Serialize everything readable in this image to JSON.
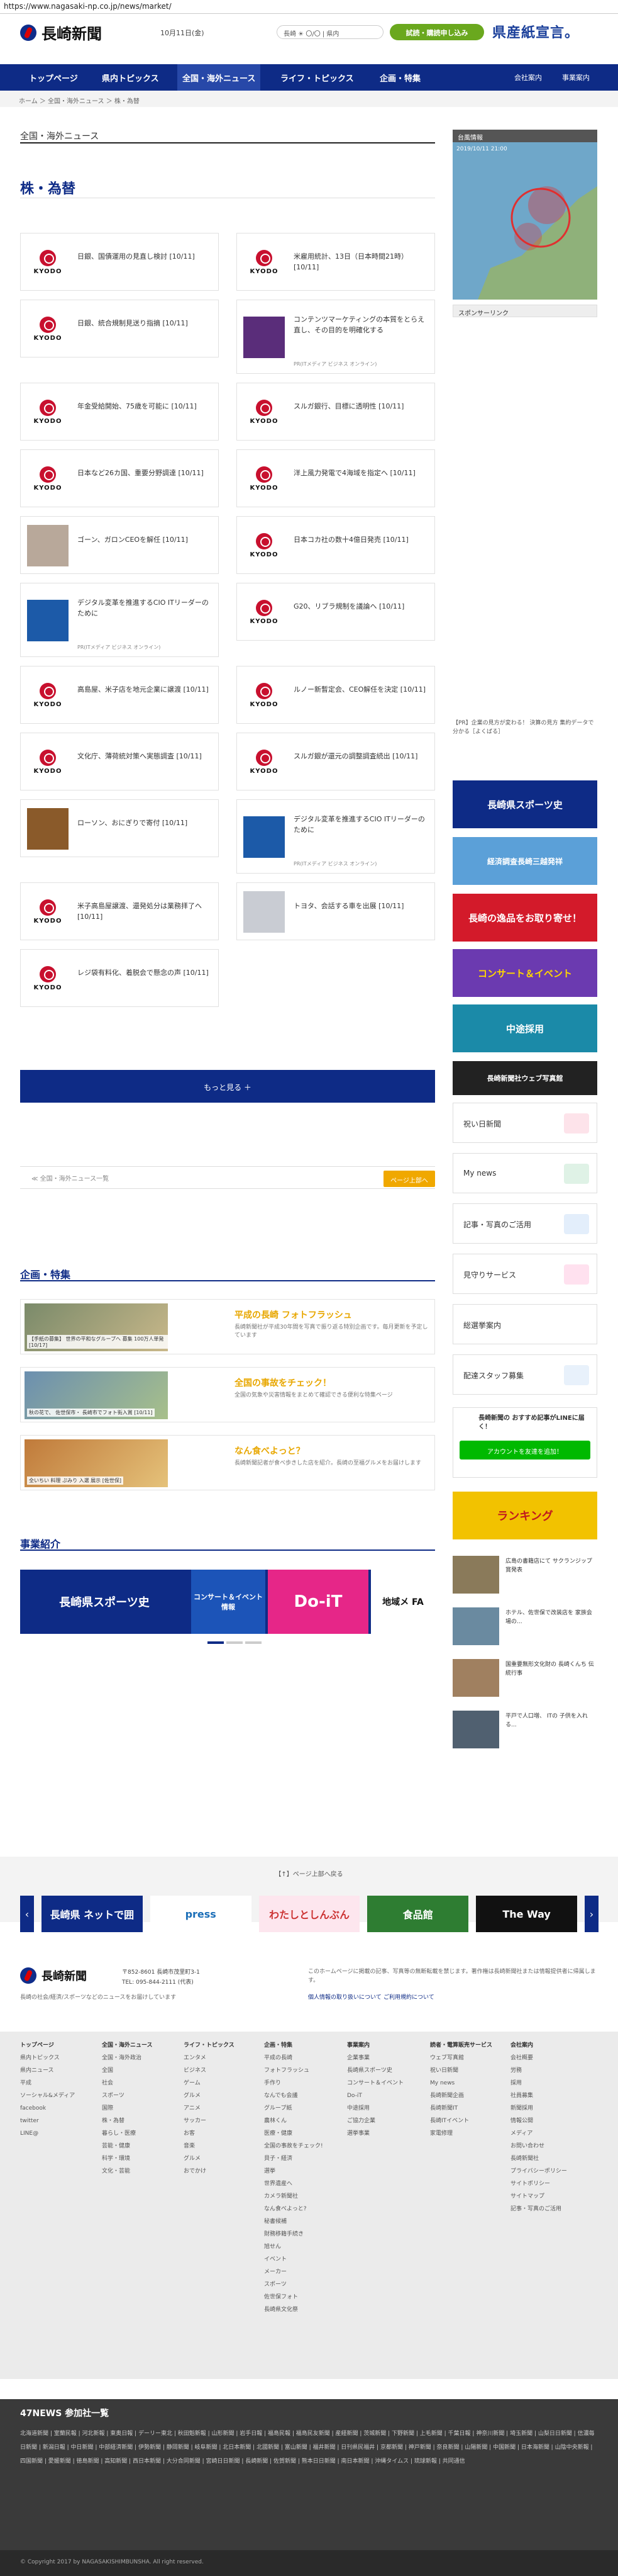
{
  "url": "https://www.nagasaki-np.co.jp/news/market/",
  "header": {
    "logo": "長崎新聞",
    "date": "10月11日(金)",
    "weather": "長崎 ☀ 〇/〇 | 県内",
    "trial_button": "試読・購読申し込み",
    "ad_text": "県産紙宣言。"
  },
  "nav": {
    "items": [
      "トップページ",
      "県内トピックス",
      "全国・海外ニュース",
      "ライフ・トピックス",
      "企画・特集"
    ],
    "right": [
      "会社案内",
      "事業案内"
    ]
  },
  "breadcrumb": "ホーム ＞ 全国・海外ニュース ＞ 株・為替",
  "section_title": "全国・海外ニュース",
  "page_title": "株・為替",
  "articles": [
    {
      "title": "日銀、国債運用の見直し検討 [10/11]",
      "src": "",
      "thumb": "kyodo"
    },
    {
      "title": "米雇用統計、13日（日本時間21時） [10/11]",
      "src": "",
      "thumb": "kyodo"
    },
    {
      "title": "日銀、統合規制見送り指摘 [10/11]",
      "src": "",
      "thumb": "kyodo"
    },
    {
      "title": "コンテンツマーケティングの本質をとらえ直し、その目的を明確化する",
      "src": "PR(ITメディア ビジネス オンライン)",
      "thumb": "purple"
    },
    {
      "title": "年金受給開始、75歳を可能に [10/11]",
      "src": "",
      "thumb": "kyodo"
    },
    {
      "title": "スルガ銀行、目標に透明性 [10/11]",
      "src": "",
      "thumb": "kyodo"
    },
    {
      "title": "日本など26カ国、重要分野調達 [10/11]",
      "src": "",
      "thumb": "kyodo"
    },
    {
      "title": "洋上風力発電で4海域を指定へ [10/11]",
      "src": "",
      "thumb": "kyodo"
    },
    {
      "title": "ゴーン、ガロンCEOを解任 [10/11]",
      "src": "",
      "thumb": "person"
    },
    {
      "title": "日本コカ社の数十4億日発売 [10/11]",
      "src": "",
      "thumb": "kyodo"
    },
    {
      "title": "デジタル変革を推進するCIO ITリーダーのために",
      "src": "PR(ITメディア ビジネス オンライン)",
      "thumb": "blue"
    },
    {
      "title": "G20、リブラ規制を議論へ [10/11]",
      "src": "",
      "thumb": "kyodo"
    },
    {
      "title": "高島屋、米子店を地元企業に譲渡 [10/11]",
      "src": "",
      "thumb": "kyodo"
    },
    {
      "title": "ルノー新暫定会、CEO解任を決定 [10/11]",
      "src": "",
      "thumb": "kyodo"
    },
    {
      "title": "文化庁、薄荷統対策へ実態調査 [10/11]",
      "src": "",
      "thumb": "kyodo"
    },
    {
      "title": "スルガ銀が還元の調整調査続出 [10/11]",
      "src": "",
      "thumb": "kyodo"
    },
    {
      "title": "ローソン、おにぎりで寄付 [10/11]",
      "src": "",
      "thumb": "food"
    },
    {
      "title": "デジタル変革を推進するCIO ITリーダーのために",
      "src": "PR(ITメディア ビジネス オンライン)",
      "thumb": "blue"
    },
    {
      "title": "米子高島屋譲渡、還発処分は業務拝了へ [10/11]",
      "src": "",
      "thumb": "kyodo"
    },
    {
      "title": "トヨタ、会話する車を出展 [10/11]",
      "src": "",
      "thumb": "car"
    },
    {
      "title": "レジ袋有料化、着脱会で懸念の声 [10/11]",
      "src": "",
      "thumb": "kyodo"
    }
  ],
  "more_button": "もっと見る ＋",
  "pager": {
    "back": "≪ 全国・海外ニュース一覧",
    "top": "ページ上部へ"
  },
  "features": {
    "title": "企画・特集",
    "items": [
      {
        "caption": "【手紙の募集】 世界の平和なグループへ 募集 100万人単発 [10/17]",
        "title": "平成の長崎 フォトフラッシュ",
        "desc": "長崎新聞社が平成30年間を写真で振り返る特別企画です。毎月更新を予定しています"
      },
      {
        "caption": "秋の花で、 佐世保市・ 長崎市でフォト街入賞 [10/11]",
        "title": "全国の事故をチェック！",
        "desc": "全国の気象や災害情報をまとめて確認できる便利な特集ページ"
      },
      {
        "caption": "全いちい 料理 ぷみり 入選 展示 [佐世保]",
        "title": "なん食べよっと？",
        "desc": "長崎新聞記者が食べ歩きした店を紹介。長崎の至福グルメをお届けします"
      }
    ]
  },
  "business": {
    "title": "事業紹介",
    "items": [
      "長崎県スポーツ史",
      "コンサート＆イベント情報",
      "Do-iT",
      "地域メ FA"
    ]
  },
  "sidebar": {
    "map_title": "台風情報",
    "map_date": "2019/10/11 21:00",
    "sponsor": "スポンサーリンク",
    "pr_link": "【PR】企業の見方が変わる！ 決算の見方 集約データで分かる［よくばる］",
    "banners": [
      "長崎県スポーツ史",
      "経済調査長崎三越発祥",
      "長崎の逸品をお取り寄せ！",
      "コンサート＆イベント",
      "中途採用",
      "長崎新聞社ウェブ写真館"
    ],
    "buttons": [
      "祝い日新聞",
      "My news",
      "記事・写真のご活用",
      "見守りサービス",
      "総選挙案内",
      "配達スタッフ募集"
    ],
    "line_title": "長崎新聞の おすすめ記事がLINEに届く！",
    "line_button": "アカウントを友達を追加！",
    "ranking": "ランキング",
    "news": [
      "広島の書籍店にて サクランジップ賞発表",
      "ホテル、佐世保で改装店を 家族会場の...",
      "国重要無形文化財の 長崎くんち 伝統行事",
      "平戸で人口増、 ITの 子供を入れる..."
    ]
  },
  "footer": {
    "pr_back": "【↑】ページ上部へ戻る",
    "carousel": [
      "長崎県 ネットで囲",
      "press",
      "わたしとしんぶん",
      "食品館",
      "The Way"
    ],
    "address": "〒852-8601 長崎市茂里町3-1",
    "tel": "TEL: 095-844-2111 (代表)",
    "note": "長崎の社会/経済/スポーツなどのニュースをお届けしています",
    "right_note": "このホームページに掲載の記事、写真等の無断転載を禁じます。著作権は長崎新聞社または情報提供者に帰属します。",
    "links": [
      "個人情報の取り扱いについて",
      "ご利用規約について"
    ],
    "cols": [
      {
        "h": "トップページ",
        "items": [
          "県内トピックス",
          "県内ニュース",
          "平成",
          "ソーシャル&メディア",
          "facebook",
          "twitter",
          "LINE@"
        ]
      },
      {
        "h": "全国・海外ニュース",
        "items": [
          "全国・海外政治",
          "全国",
          "社会",
          "スポーツ",
          "国際",
          "株・為替",
          "暮らし・医療",
          "芸能・健康",
          "科学・環境",
          "文化・芸能"
        ]
      },
      {
        "h": "ライフ・トピックス",
        "items": [
          "エンタメ",
          "ビジネス",
          "ゲーム",
          "グルメ",
          "アニメ",
          "サッカー",
          "お客",
          "音楽",
          "グルメ",
          "おでかけ"
        ]
      },
      {
        "h": "企画・特集",
        "items": [
          "平成の長崎",
          "フォトフラッシュ",
          "手作り",
          "なんでも会議",
          "グループ紙",
          "農林くん",
          "医療・健康",
          "全国の事故をチェック!",
          "貝子・経済",
          "選挙",
          "世界遺産へ",
          "カメラ新聞社",
          "なん食べよっと?",
          "秘書候補",
          "財務移籍手続き",
          "旭せん",
          "イベント",
          "メーカー",
          "スポーツ",
          "佐世保フォト",
          "長崎県文化祭"
        ]
      },
      {
        "h": "事業案内",
        "items": [
          "企業事業",
          "長崎県スポーツ史",
          "コンサート＆イベント",
          "Do-iT",
          "中途採用",
          "ご協力企業",
          "選挙事業"
        ]
      },
      {
        "h": "読者・電算販売サービス",
        "items": [
          "ウェブ写真館",
          "祝い日新聞",
          "My news",
          "長崎新聞企画",
          "長崎新聞IT",
          "長崎ITイベント",
          "家電修理"
        ]
      },
      {
        "h": "会社案内",
        "items": [
          "会社概要",
          "労務",
          "採用",
          "社員募集",
          "新聞採用",
          "情報公開",
          "メディア",
          "お問い合わせ",
          "長崎新聞社",
          "プライバシーポリシー",
          "サイトポリシー",
          "サイトマップ",
          "記事・写真のご活用"
        ]
      }
    ]
  },
  "n47": {
    "title": "47NEWS 参加社一覧",
    "list": "北海道新聞 | 室蘭民報 | 河北新報 | 東奥日報 | デーリー東北 | 秋田魁新報 | 山形新聞 | 岩手日報 | 福島民報 | 福島民友新聞 | 産経新聞 | 茨城新聞 | 下野新聞 | 上毛新聞 | 千葉日報 | 神奈川新聞 | 埼玉新聞 | 山梨日日新聞 | 信濃毎日新聞 | 新潟日報 | 中日新聞 | 中部経済新聞 | 伊勢新聞 | 静岡新聞 | 岐阜新聞 | 北日本新聞 | 北國新聞 | 富山新聞 | 福井新聞 | 日刊県民福井 | 京都新聞 | 神戸新聞 | 奈良新聞 | 山陽新聞 | 中国新聞 | 日本海新聞 | 山陰中央新報 | 四国新聞 | 愛媛新聞 | 徳島新聞 | 高知新聞 | 西日本新聞 | 大分合同新聞 | 宮崎日日新聞 | 長崎新聞 | 佐賀新聞 | 熊本日日新聞 | 南日本新聞 | 沖縄タイムス | 琉球新報 | 共同通信"
  },
  "copyright": "© Copyright 2017 by NAGASAKISHIMBUNSHA. All right reserved.",
  "colors": {
    "brand": "#0e2b86",
    "accent": "#e8a700",
    "line": "#00b900"
  }
}
